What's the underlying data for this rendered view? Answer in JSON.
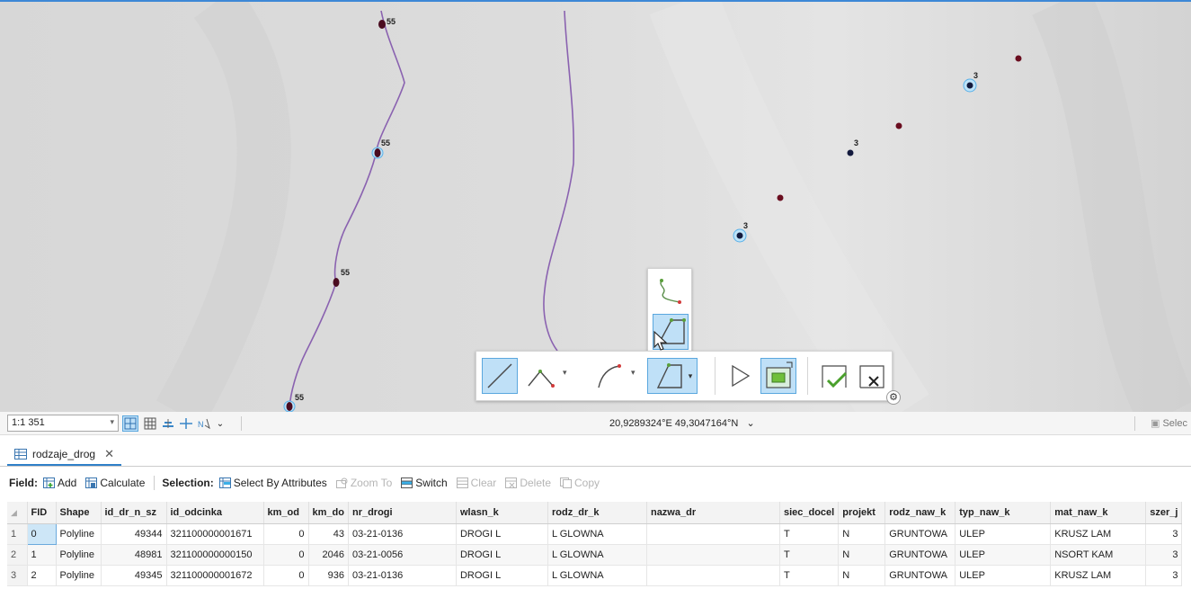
{
  "map": {
    "line_labels": [
      "55",
      "55",
      "55",
      "55"
    ],
    "point_labels": [
      "3",
      "3",
      "3"
    ]
  },
  "sketch_toolbar": {
    "tools": [
      {
        "name": "line-tool-icon",
        "active": true
      },
      {
        "name": "polyline-tool-icon",
        "active": false
      },
      {
        "name": "arc-tool-icon",
        "active": false
      },
      {
        "name": "polygon-tool-icon",
        "active": true
      },
      {
        "name": "select-pointer-icon",
        "active": false
      },
      {
        "name": "rectangle-select-icon",
        "active": true
      },
      {
        "name": "finish-sketch-icon",
        "active": false
      },
      {
        "name": "cancel-sketch-icon",
        "active": false
      }
    ]
  },
  "statusbar": {
    "scale": "1:1 351",
    "coordinates": "20,9289324°E 49,3047164°N",
    "coordinates_caret": "⌄",
    "select_label": "Selec"
  },
  "table_tab": {
    "title": "rodzaje_drog",
    "close": "✕"
  },
  "table_toolbar": {
    "field_label": "Field:",
    "add": "Add",
    "calculate": "Calculate",
    "selection_label": "Selection:",
    "select_by_attributes": "Select By Attributes",
    "zoom_to": "Zoom To",
    "switch": "Switch",
    "clear": "Clear",
    "delete": "Delete",
    "copy": "Copy"
  },
  "table": {
    "columns": [
      "FID",
      "Shape",
      "id_dr_n_sz",
      "id_odcinka",
      "km_od",
      "km_do",
      "nr_drogi",
      "wlasn_k",
      "rodz_dr_k",
      "nazwa_dr",
      "siec_docel",
      "projekt",
      "rodz_naw_k",
      "typ_naw_k",
      "mat_naw_k",
      "szer_j"
    ],
    "rows": [
      {
        "rn": "1",
        "cells": [
          "0",
          "Polyline",
          "49344",
          "321100000001671",
          "0",
          "43",
          "03-21-0136",
          "DROGI L",
          "L GLOWNA",
          "",
          "T",
          "N",
          "GRUNTOWA",
          "ULEP",
          "KRUSZ LAM",
          "3"
        ]
      },
      {
        "rn": "2",
        "cells": [
          "1",
          "Polyline",
          "48981",
          "321100000000150",
          "0",
          "2046",
          "03-21-0056",
          "DROGI L",
          "L GLOWNA",
          "",
          "T",
          "N",
          "GRUNTOWA",
          "ULEP",
          "NSORT KAM",
          "3"
        ]
      },
      {
        "rn": "3",
        "cells": [
          "2",
          "Polyline",
          "49345",
          "321100000001672",
          "0",
          "936",
          "03-21-0136",
          "DROGI L",
          "L GLOWNA",
          "",
          "T",
          "N",
          "GRUNTOWA",
          "ULEP",
          "KRUSZ LAM",
          "3"
        ]
      }
    ]
  }
}
